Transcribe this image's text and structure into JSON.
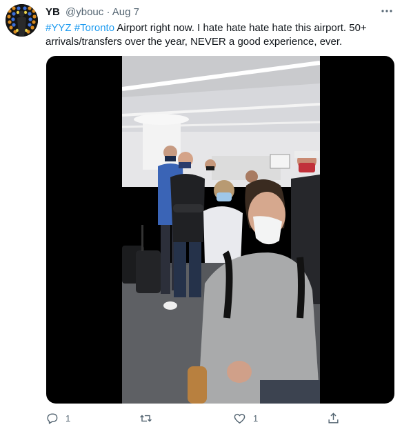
{
  "tweet": {
    "display_name": "YB",
    "handle": "@ybouc",
    "separator": "·",
    "date": "Aug 7",
    "more_label": "···",
    "text": {
      "hashtag_1": "#YYZ",
      "hashtag_2": "#Toronto",
      "body": " Airport right now. I hate hate hate hate this airport. 50+ arrivals/transfers over the year, NEVER a good experience, ever."
    },
    "media_icon": "airport-queue-video",
    "actions": {
      "reply_count": "1",
      "retweet_count": "",
      "like_count": "1",
      "share_count": ""
    }
  },
  "colors": {
    "link": "#1d9bf0",
    "text": "#0f1419",
    "secondary": "#536471",
    "media_bg": "#000000"
  }
}
